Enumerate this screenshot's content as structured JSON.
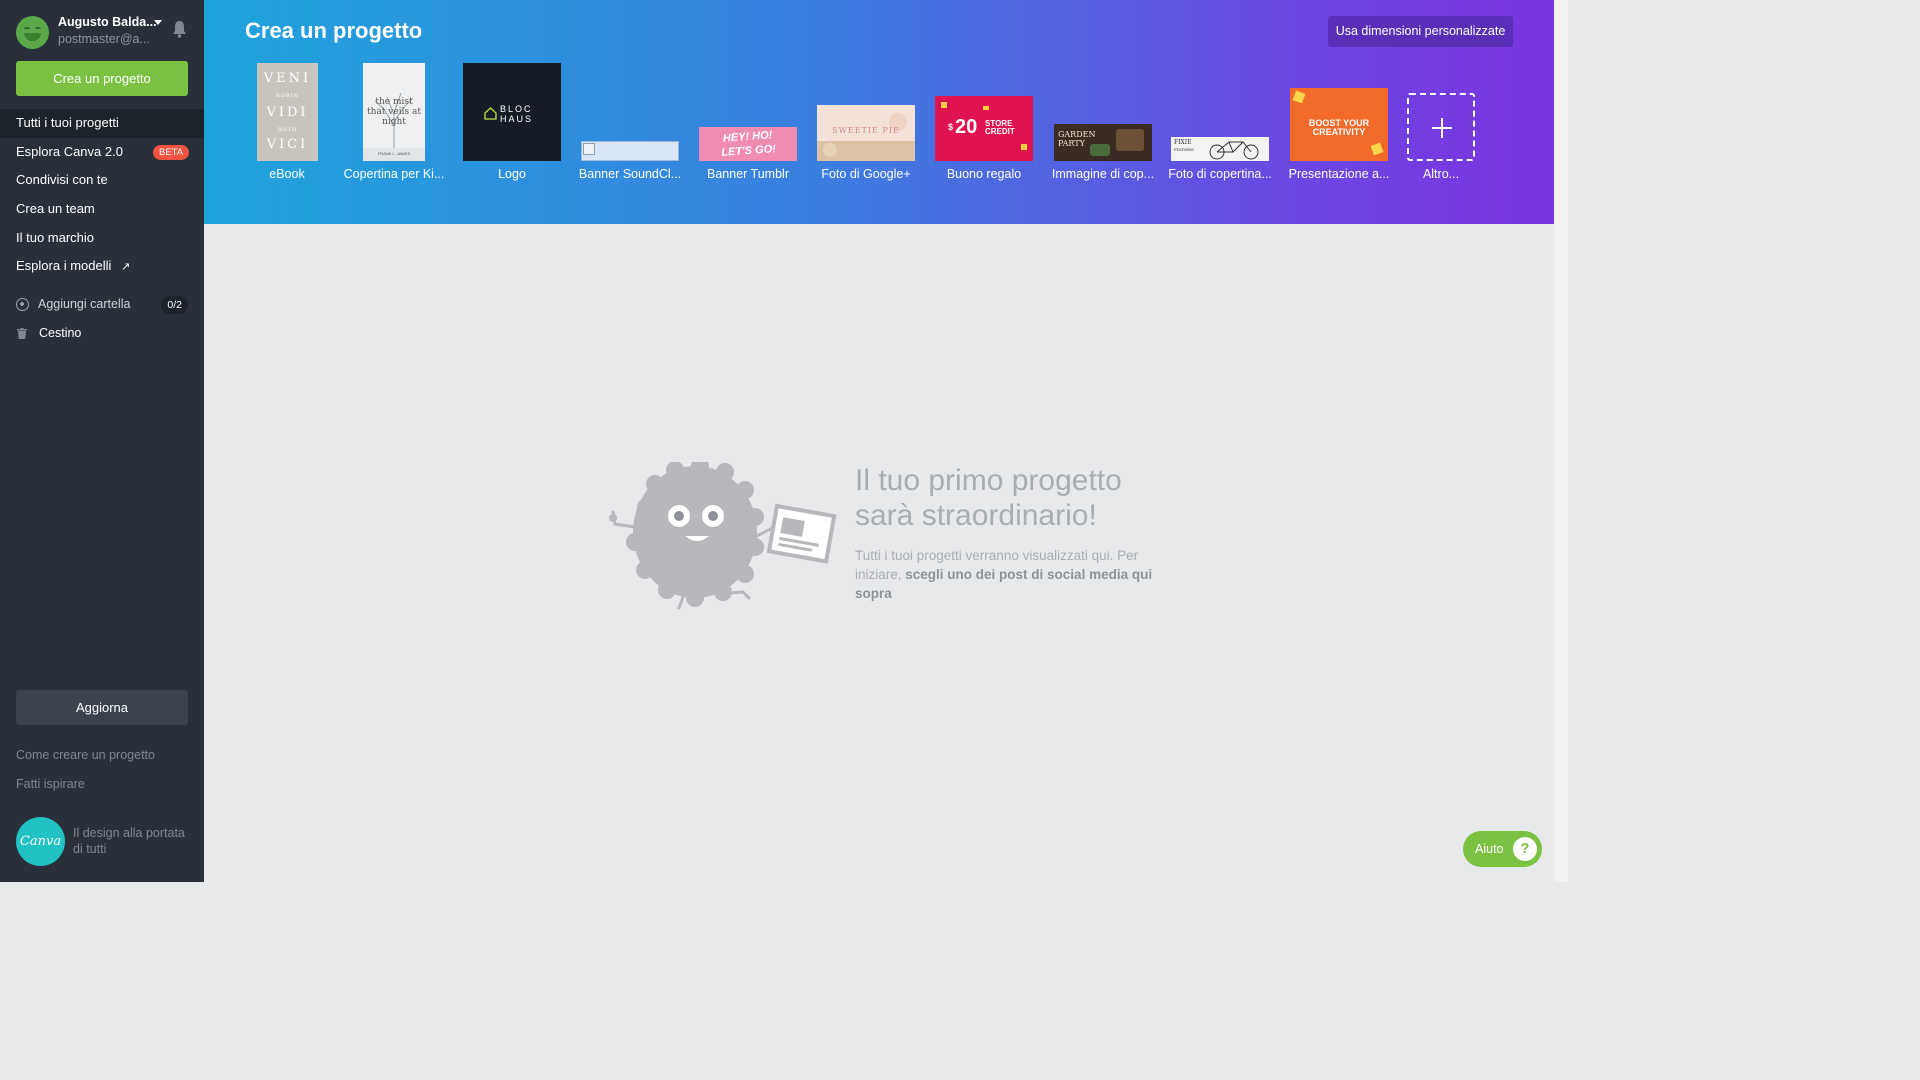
{
  "user": {
    "name": "Augusto Balda...",
    "email": "postmaster@a..."
  },
  "sidebar": {
    "create_button": "Crea un progetto",
    "nav": [
      {
        "label": "Tutti i tuoi progetti"
      },
      {
        "label": "Esplora Canva 2.0",
        "badge": "BETA"
      },
      {
        "label": "Condivisi con te"
      },
      {
        "label": "Crea un team"
      },
      {
        "label": "Il tuo marchio"
      },
      {
        "label": "Esplora i modelli"
      }
    ],
    "add_folder": {
      "label": "Aggiungi cartella",
      "count": "0/2"
    },
    "trash": "Cestino",
    "upgrade_button": "Aggiorna",
    "links": [
      "Come creare un progetto",
      "Fatti ispirare"
    ],
    "brand_logo_text": "Canva",
    "brand_tagline": "Il design alla portata di tutti"
  },
  "header": {
    "title": "Crea un progetto",
    "custom_button": "Usa dimensioni personalizzate",
    "templates": [
      {
        "label": "eBook",
        "thumb_text": [
          "VENI",
          "VIDI",
          "VICI"
        ],
        "thumb_small": [
          "ROBIN",
          "ROTH"
        ]
      },
      {
        "label": "Copertina per Ki...",
        "thumb_text": "the mist that veils at night",
        "thumb_small": "FRANK L. JAMES"
      },
      {
        "label": "Logo",
        "thumb_text": [
          "BLOC",
          "HAUS"
        ]
      },
      {
        "label": "Banner SoundCl..."
      },
      {
        "label": "Banner Tumblr",
        "thumb_text": [
          "HEY! HO!",
          "LET'S GO!"
        ]
      },
      {
        "label": "Foto di Google+",
        "thumb_text": "SWEETIE PIE"
      },
      {
        "label": "Buono regalo",
        "thumb_text": [
          "$",
          "20",
          "STORE",
          "CREDIT"
        ]
      },
      {
        "label": "Immagine di cop...",
        "thumb_text": [
          "GARDEN",
          "PARTY"
        ]
      },
      {
        "label": "Foto di copertina...",
        "thumb_text": [
          "FIXIE",
          "FINDERS"
        ]
      },
      {
        "label": "Presentazione a...",
        "thumb_text": [
          "BOOST YOUR",
          "CREATIVITY"
        ]
      },
      {
        "label": "Altro..."
      }
    ]
  },
  "empty_state": {
    "headline": "Il tuo primo progetto sarà straordinario!",
    "text_before": "Tutti i tuoi progetti verranno visualizzati qui. Per iniziare, ",
    "text_bold": "scegli uno dei post di social media qui sopra"
  },
  "help": {
    "label": "Aiuto",
    "icon": "?"
  },
  "colors": {
    "sidebar_bg": "#293039",
    "accent_green": "#7cc242",
    "header_gradient_start": "#1ea4dc",
    "header_gradient_end": "#7b33e0",
    "beta_badge": "#f0533f"
  }
}
